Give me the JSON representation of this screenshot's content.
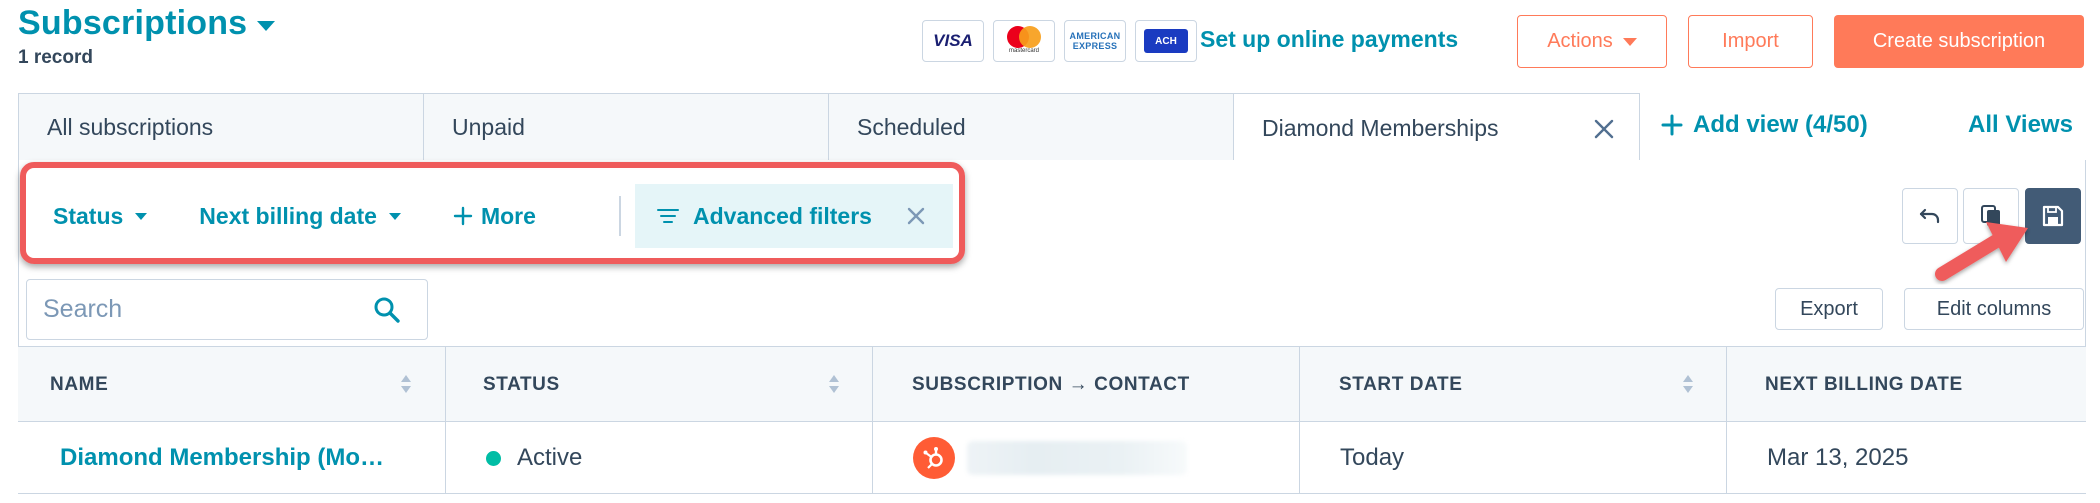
{
  "header": {
    "title": "Subscriptions",
    "record_count": "1 record",
    "payment_cards": {
      "visa": "VISA",
      "mastercard": "mastercard",
      "amex_line1": "AMERICAN",
      "amex_line2": "EXPRESS",
      "ach": "ACH"
    },
    "setup_payments_link": "Set up online payments",
    "actions_label": "Actions",
    "import_label": "Import",
    "create_label": "Create subscription"
  },
  "tabs": [
    {
      "label": "All subscriptions"
    },
    {
      "label": "Unpaid"
    },
    {
      "label": "Scheduled"
    },
    {
      "label": "Diamond Memberships"
    }
  ],
  "add_view_label": "Add view (4/50)",
  "all_views_label": "All Views",
  "filters": {
    "status_label": "Status",
    "next_billing_label": "Next billing date",
    "more_label": "More",
    "advanced_label": "Advanced filters"
  },
  "search": {
    "placeholder": "Search"
  },
  "table_actions": {
    "export_label": "Export",
    "edit_columns_label": "Edit columns"
  },
  "table": {
    "columns": [
      "NAME",
      "STATUS",
      "SUBSCRIPTION → CONTACT",
      "START DATE",
      "NEXT BILLING DATE"
    ],
    "rows": [
      {
        "name": "Diamond Membership (Mo…",
        "status": "Active",
        "start_date": "Today",
        "next_billing_date": "Mar 13, 2025"
      }
    ]
  },
  "colors": {
    "accent_teal": "#0091ae",
    "accent_orange": "#ff7a59",
    "highlight_red": "#ef5b5b",
    "status_active": "#00bda5",
    "save_button": "#425b76"
  }
}
